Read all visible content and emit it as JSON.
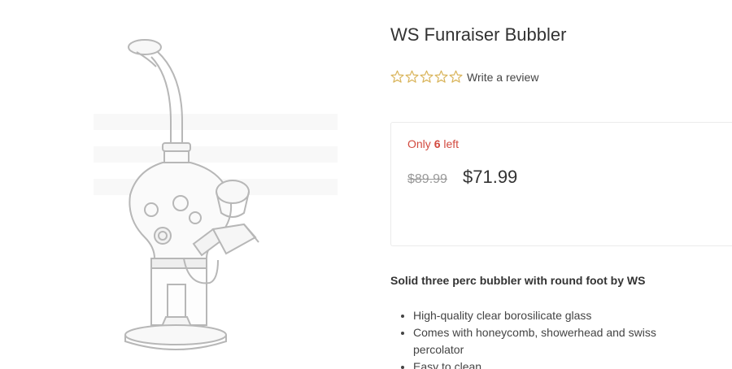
{
  "product": {
    "title": "WS Funraiser Bubbler",
    "image_alt": "WS Funraiser Bubbler glass bubbler product image"
  },
  "rating": {
    "stars_filled": 0,
    "stars_total": 5,
    "review_link": "Write a review",
    "star_color": "#d9b45a"
  },
  "stock": {
    "prefix": "Only",
    "count": "6",
    "suffix": "left",
    "color": "#d24a3f"
  },
  "pricing": {
    "old_price": "$89.99",
    "new_price": "$71.99"
  },
  "description": {
    "heading": "Solid three perc bubbler with round foot by WS",
    "features": [
      "High-quality clear borosilicate glass",
      "Comes with honeycomb, showerhead and swiss percolator",
      "Easy to clean"
    ]
  }
}
